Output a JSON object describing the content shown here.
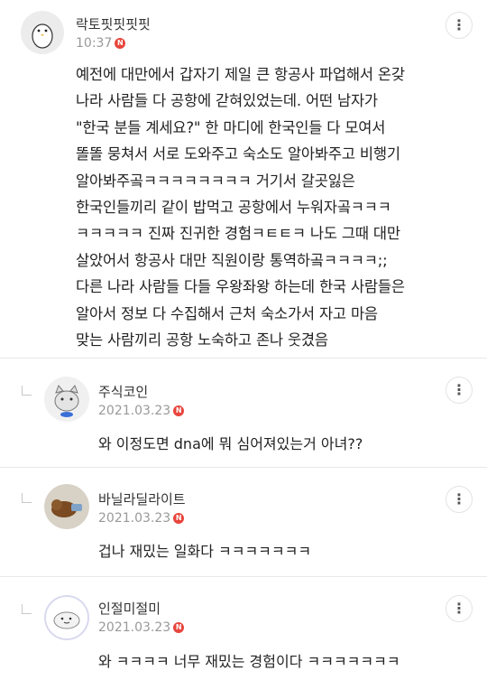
{
  "main_comment": {
    "author": "락토핏핏핏핏",
    "time": "10:37",
    "new_badge": "N",
    "text": "예전에 대만에서 갑자기 제일 큰 항공사 파업해서 온갖\n나라 사람들 다 공항에 갇혀있었는데. 어떤 남자가\n\"한국 분들 계세요?\" 한 마디에 한국인들 다 모여서\n똘똘 뭉쳐서 서로 도와주고 숙소도 알아봐주고 비행기\n알아봐주곸ㅋㅋㅋㅋㅋㅋㅋㅋ 거기서 갈곳잃은\n한국인들끼리 같이 밥먹고 공항에서 누워자곸ㅋㅋㅋ\nㅋㅋㅋㅋㅋ 진짜 진귀한 경험ㅋㅌㅌㅋ 나도 그때 대만\n살았어서 항공사 대만 직원이랑 통역하곸ㅋㅋㅋㅋ;;\n다른 나라 사람들 다들 우왕좌왕 하는데 한국 사람들은\n알아서 정보 다 수집해서 근처 숙소가서 자고 마음\n맞는 사람끼리 공항 노숙하고 존나 웃겼음"
  },
  "replies": [
    {
      "author": "주식코인",
      "date": "2021.03.23",
      "new_badge": "N",
      "text": "와 이정도면 dna에 뭐 심어져있는거 아녀??"
    },
    {
      "author": "바닐라딜라이트",
      "date": "2021.03.23",
      "new_badge": "N",
      "text": "겁나 재밌는 일화다 ㅋㅋㅋㅋㅋㅋㅋ"
    },
    {
      "author": "인절미절미",
      "date": "2021.03.23",
      "new_badge": "N",
      "text": "와 ㅋㅋㅋㅋ 너무 재밌는 경험이다 ㅋㅋㅋㅋㅋㅋㅋ"
    }
  ],
  "more_icon": "⋮",
  "colors": {
    "badge": "#e8453c",
    "meta": "#999999",
    "divider": "#e8e8e8"
  }
}
